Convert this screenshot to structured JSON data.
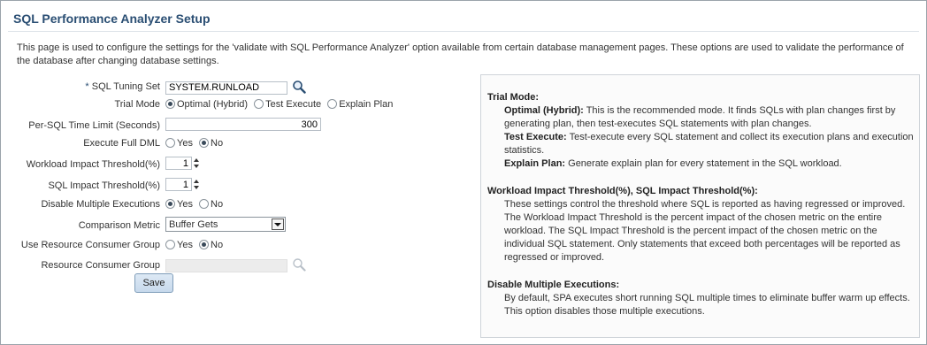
{
  "page": {
    "title": "SQL Performance Analyzer Setup",
    "intro": "This page is used to configure the settings for the 'validate with SQL Performance Analyzer' option available from certain database management pages. These options are used to validate the performance of the database after changing database settings."
  },
  "form": {
    "tuning_set": {
      "required_mark": "*",
      "label": "SQL Tuning Set",
      "value": "SYSTEM.RUNLOAD",
      "icon": "search-icon"
    },
    "trial_mode": {
      "label": "Trial Mode",
      "options": [
        "Optimal (Hybrid)",
        "Test Execute",
        "Explain Plan"
      ],
      "selected": "Optimal (Hybrid)"
    },
    "time_limit": {
      "label": "Per-SQL Time Limit (Seconds)",
      "value": "300"
    },
    "execute_full_dml": {
      "label": "Execute Full DML",
      "options": [
        "Yes",
        "No"
      ],
      "selected": "No"
    },
    "workload_threshold": {
      "label": "Workload Impact Threshold(%)",
      "value": "1"
    },
    "sql_threshold": {
      "label": "SQL Impact Threshold(%)",
      "value": "1"
    },
    "disable_multiple": {
      "label": "Disable Multiple Executions",
      "options": [
        "Yes",
        "No"
      ],
      "selected": "Yes"
    },
    "comparison_metric": {
      "label": "Comparison Metric",
      "value": "Buffer Gets"
    },
    "use_rcg": {
      "label": "Use Resource Consumer Group",
      "options": [
        "Yes",
        "No"
      ],
      "selected": "No"
    },
    "rcg": {
      "label": "Resource Consumer Group",
      "value": "",
      "icon": "search-icon"
    },
    "save_label": "Save"
  },
  "help": {
    "trial_heading": "Trial Mode:",
    "optimal_term": "Optimal (Hybrid):",
    "optimal_desc": " This is the recommended mode. It finds SQLs with plan changes first by generating plan, then test-executes SQL statements with plan changes.",
    "test_term": "Test Execute:",
    "test_desc": " Test-execute every SQL statement and collect its execution plans and execution statistics.",
    "explain_term": "Explain Plan:",
    "explain_desc": " Generate explain plan for every statement in the SQL workload.",
    "threshold_heading": "Workload Impact Threshold(%), SQL Impact Threshold(%):",
    "threshold_desc": "These settings control the threshold where SQL is reported as having regressed or improved. The Workload Impact Threshold is the percent impact of the chosen metric on the entire workload. The SQL Impact Threshold is the percent impact of the chosen metric on the individual SQL statement. Only statements that exceed both percentages will be reported as regressed or improved.",
    "disable_heading": "Disable Multiple Executions:",
    "disable_desc": "By default, SPA executes short running SQL multiple times to eliminate buffer warm up effects. This option disables those multiple executions."
  }
}
